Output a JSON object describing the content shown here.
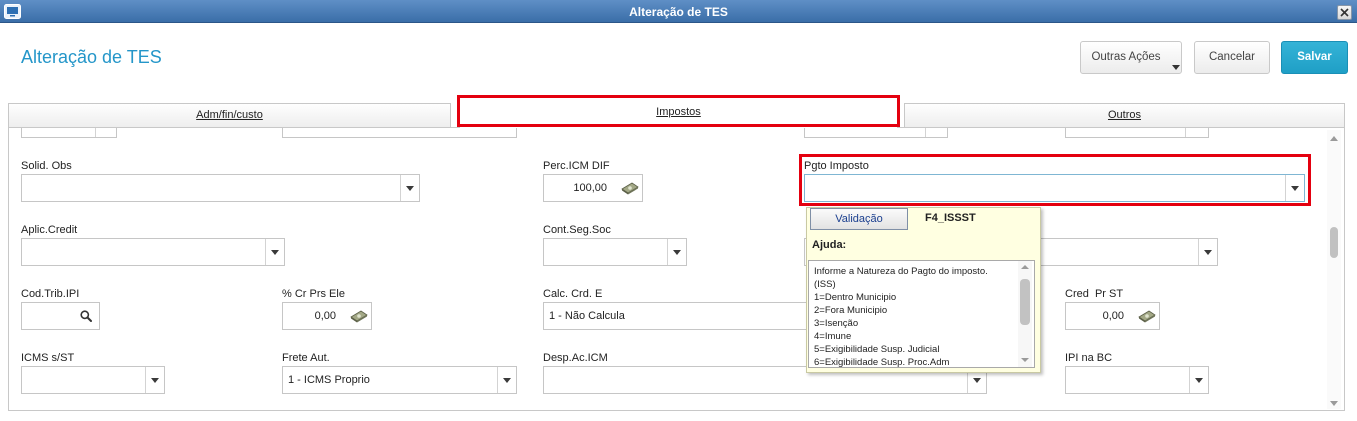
{
  "window": {
    "title": "Alteração de TES"
  },
  "header": {
    "title": "Alteração de TES",
    "more_actions_label": "Outras Ações",
    "cancel_label": "Cancelar",
    "save_label": "Salvar"
  },
  "tabs": [
    {
      "label": "Adm/fin/custo",
      "selected": false
    },
    {
      "label": "Impostos",
      "selected": true
    },
    {
      "label": "Outros",
      "selected": false
    }
  ],
  "form": {
    "solid_obs": {
      "label": "Solid. Obs",
      "value": ""
    },
    "perc_icm_dif": {
      "label": "Perc.ICM DIF",
      "value": "100,00"
    },
    "pgto_imposto": {
      "label": "Pgto Imposto",
      "value": ""
    },
    "aplic_credit": {
      "label": "Aplic.Credit",
      "value": ""
    },
    "cont_seg_soc": {
      "label": "Cont.Seg.Soc",
      "value": ""
    },
    "cod_trib_ipi": {
      "label": "Cod.Trib.IPI",
      "value": ""
    },
    "cr_prs_ele": {
      "label": "% Cr Prs Ele",
      "value": "0,00"
    },
    "calc_crd_e": {
      "label": "Calc. Crd. E",
      "value": "1 - Não Calcula"
    },
    "cred_pr_st": {
      "label": "Cred  Pr ST",
      "value": "0,00"
    },
    "icms_s_st": {
      "label": "ICMS s/ST",
      "value": ""
    },
    "frete_aut": {
      "label": "Frete Aut.",
      "value": "1 - ICMS Proprio"
    },
    "desp_ac_icm": {
      "label": "Desp.Ac.ICM",
      "value": ""
    },
    "ipi_na_bc": {
      "label": "IPI na BC",
      "value": ""
    }
  },
  "help_popup": {
    "validation_button": "Validação",
    "field_code": "F4_ISSST",
    "help_title": "Ajuda:",
    "help_lines": [
      "Informe a Natureza do Pagto do imposto.",
      "(ISS)",
      "1=Dentro Municipio",
      "2=Fora Municipio",
      "3=Isenção",
      "4=Imune",
      "5=Exigibilidade Susp. Judicial",
      "6=Exigibilidade Susp. Proc.Adm"
    ]
  },
  "colors": {
    "accent": "#2496c9",
    "save_button": "#1f9fc6",
    "highlight": "#e4000f",
    "popup_background": "#ffffe1",
    "title_bar": "#3a6ea8"
  },
  "icons": {
    "window": "window-icon",
    "close": "close-icon",
    "dropdown": "chevron-down-icon",
    "numeric_helper": "calculator-icon",
    "lookup": "search-icon",
    "more_actions": "triangle-down-icon"
  }
}
